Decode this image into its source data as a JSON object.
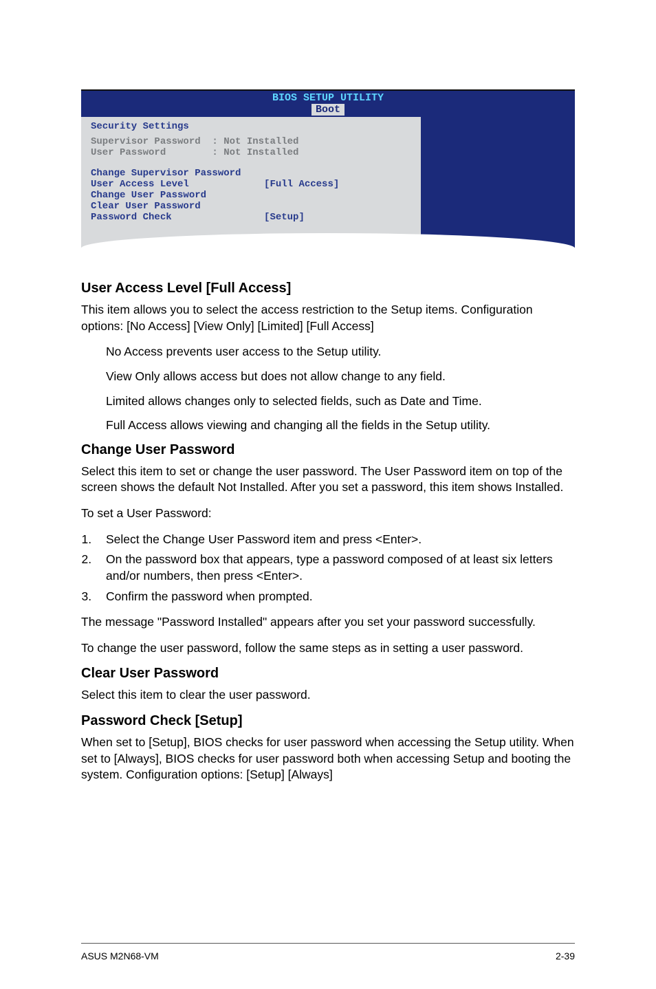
{
  "bios": {
    "title_line1": "BIOS SETUP UTILITY",
    "tab": "Boot",
    "section_header": "Security Settings",
    "status_line1": "Supervisor Password  : Not Installed",
    "status_line2": "User Password        : Not Installed",
    "item_change_supervisor": "Change Supervisor Password",
    "item_user_access": "User Access Level             [Full Access]",
    "item_change_user": "Change User Password",
    "item_clear_user": "Clear User Password",
    "item_password_check": "Password Check                [Setup]"
  },
  "sections": {
    "ual_heading": "User Access Level [Full Access]",
    "ual_p1": "This item allows you to select the access restriction to the Setup items. Configuration options: [No Access] [View Only] [Limited] [Full Access]",
    "ual_noaccess": "No Access prevents user access to the Setup utility.",
    "ual_viewonly": "View Only allows access but does not allow change to any field.",
    "ual_limited": "Limited allows changes only to selected fields, such as Date and Time.",
    "ual_fullaccess": "Full Access allows viewing and changing all the fields in the Setup utility.",
    "cup_heading": "Change User Password",
    "cup_p1": "Select this item to set or change the user password. The User Password item on top of the screen shows the default Not Installed. After you set a password, this item shows Installed.",
    "cup_p2": "To set a User Password:",
    "cup_step1": "Select the Change User Password item and press <Enter>.",
    "cup_step2": "On the password box that appears, type a password composed of at least six letters and/or numbers, then press <Enter>.",
    "cup_step3": "Confirm the password when prompted.",
    "cup_p3": "The message \"Password Installed\" appears after you set your password successfully.",
    "cup_p4": "To change the user password, follow the same steps as in setting a user password.",
    "clr_heading": "Clear User Password",
    "clr_p1": "Select this item to clear the user password.",
    "pwc_heading": "Password Check [Setup]",
    "pwc_p1": "When set to [Setup], BIOS checks for user password when accessing the Setup utility. When set to [Always], BIOS checks for user password both when accessing Setup and booting the system. Configuration options: [Setup] [Always]"
  },
  "footer": {
    "left": "ASUS M2N68-VM",
    "right": "2-39"
  }
}
